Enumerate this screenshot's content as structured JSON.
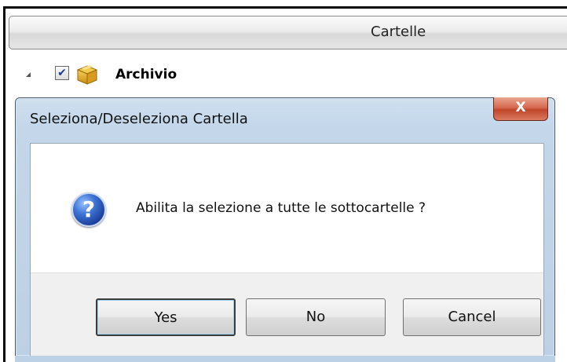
{
  "header": {
    "title": "Cartelle"
  },
  "tree": {
    "expand_icon": "triangle-expanded-icon",
    "checked": true,
    "checkbox_glyph": "✔",
    "folder_icon": "archive-box-icon",
    "label": "Archivio"
  },
  "dialog": {
    "title": "Seleziona/Deseleziona Cartella",
    "close_label": "X",
    "icon": "question-icon",
    "icon_glyph": "?",
    "message": "Abilita la selezione a tutte le sottocartelle ?",
    "buttons": {
      "yes": "Yes",
      "no": "No",
      "cancel": "Cancel"
    }
  },
  "colors": {
    "dialog_frame": "#bdd1e6",
    "close_button": "#c0452a",
    "question_icon": "#3f76d6"
  }
}
